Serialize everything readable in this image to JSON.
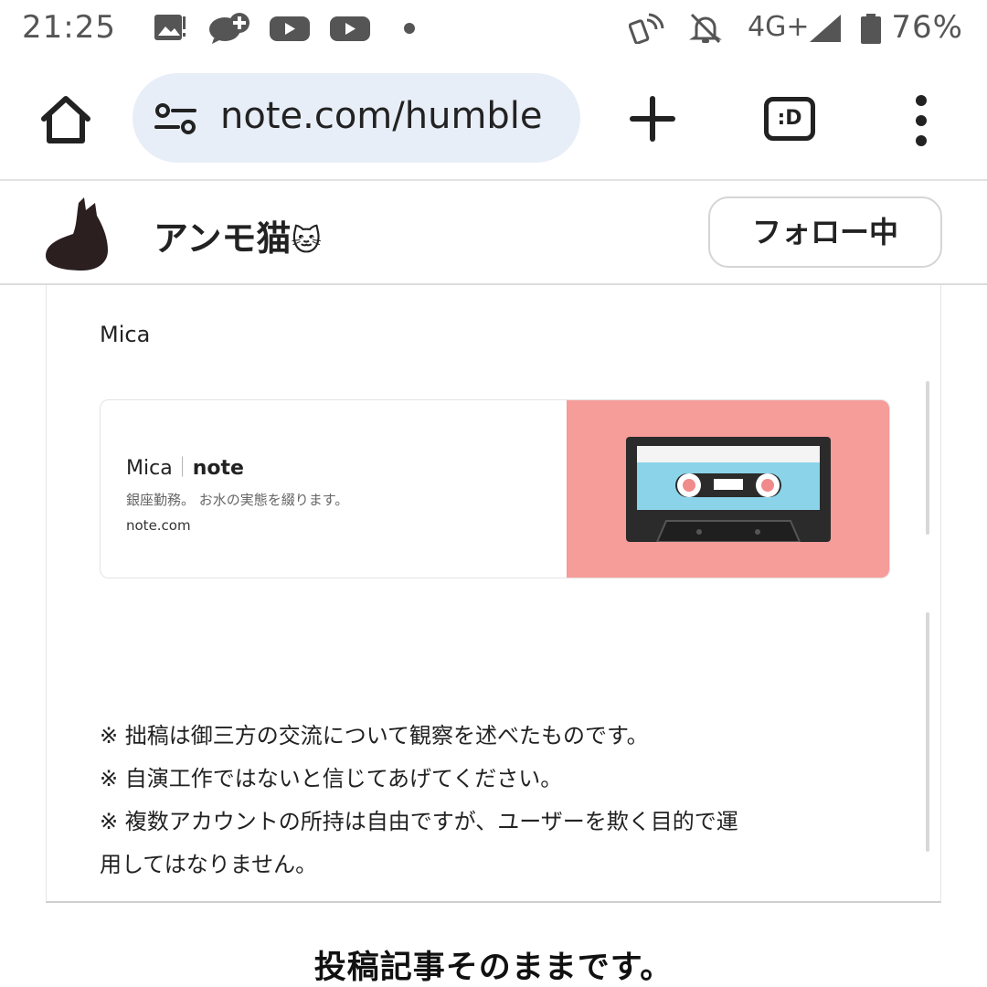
{
  "status_bar": {
    "time": "21:25",
    "network": "4G+",
    "battery": "76%",
    "icons": [
      "gallery-icon",
      "chat-plus-icon",
      "youtube-icon",
      "youtube-icon",
      "dot-icon",
      "nfc-icon",
      "bell-off-icon",
      "signal-icon",
      "battery-icon"
    ]
  },
  "browser": {
    "url": "note.com/humble",
    "tabs_label": ":D",
    "icons": [
      "home-icon",
      "tune-icon",
      "plus-icon",
      "more-vert-icon"
    ]
  },
  "profile": {
    "name": "アンモ猫",
    "emoji": "🐱",
    "follow_label": "フォロー中",
    "avatar_icon": "cat-silhouette-icon"
  },
  "card": {
    "author": "Mica",
    "link_card": {
      "title_name": "Mica",
      "title_sep": "｜",
      "title_site": "note",
      "description": "銀座勤務。 お水の実態を綴ります。",
      "domain": "note.com",
      "thumbnail_icon": "cassette-tape-icon",
      "thumbnail_bg": "#f69c99"
    },
    "notes": [
      "※ 拙稿は御三方の交流について観察を述べたものです。",
      "※ 自演工作ではないと信じてあげてください。",
      "※ 複数アカウントの所持は自由ですが、ユーザーを欺く目的で運",
      "用してはなりません。"
    ]
  },
  "caption": "投稿記事そのままです。"
}
